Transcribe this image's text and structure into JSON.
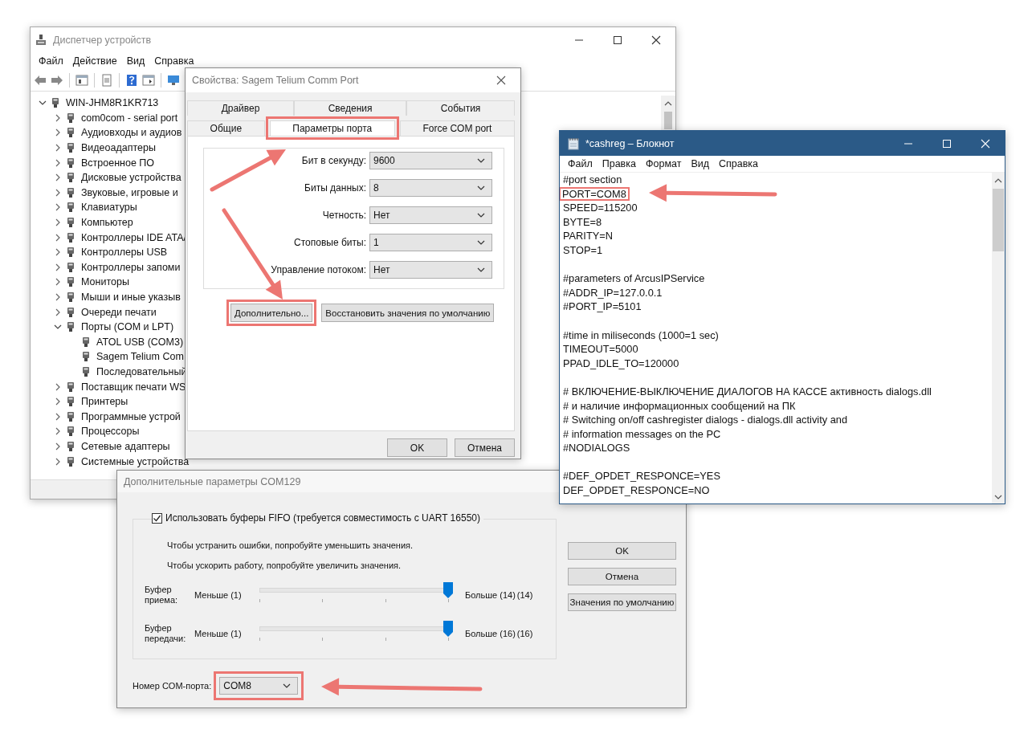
{
  "device_manager": {
    "title": "Диспетчер устройств",
    "menu": [
      "Файл",
      "Действие",
      "Вид",
      "Справка"
    ],
    "tree": [
      {
        "label": "WIN-JHM8R1KR713",
        "expanded": true,
        "children": [
          {
            "label": "com0com - serial port",
            "expanded": false
          },
          {
            "label": "Аудиовходы и аудиов",
            "expanded": false
          },
          {
            "label": "Видеоадаптеры",
            "expanded": false
          },
          {
            "label": "Встроенное ПО",
            "expanded": false
          },
          {
            "label": "Дисковые устройства",
            "expanded": false
          },
          {
            "label": "Звуковые, игровые и",
            "expanded": false
          },
          {
            "label": "Клавиатуры",
            "expanded": false
          },
          {
            "label": "Компьютер",
            "expanded": false
          },
          {
            "label": "Контроллеры IDE ATA/",
            "expanded": false
          },
          {
            "label": "Контроллеры USB",
            "expanded": false
          },
          {
            "label": "Контроллеры запоми",
            "expanded": false
          },
          {
            "label": "Мониторы",
            "expanded": false
          },
          {
            "label": "Мыши и иные указыв",
            "expanded": false
          },
          {
            "label": "Очереди печати",
            "expanded": false
          },
          {
            "label": "Порты (COM и LPT)",
            "expanded": true,
            "children": [
              {
                "label": "ATOL USB (COM3)"
              },
              {
                "label": "Sagem Telium Com"
              },
              {
                "label": "Последовательный"
              }
            ]
          },
          {
            "label": "Поставщик печати WS",
            "expanded": false
          },
          {
            "label": "Принтеры",
            "expanded": false
          },
          {
            "label": "Программные устрой",
            "expanded": false
          },
          {
            "label": "Процессоры",
            "expanded": false
          },
          {
            "label": "Сетевые адаптеры",
            "expanded": false
          },
          {
            "label": "Системные устройства",
            "expanded": false
          }
        ]
      }
    ]
  },
  "properties_dialog": {
    "title": "Свойства: Sagem Telium Comm Port",
    "tab_rows": [
      [
        {
          "label": "Драйвер",
          "selected": false,
          "highlighted": false
        },
        {
          "label": "Сведения",
          "selected": false,
          "highlighted": false
        },
        {
          "label": "События",
          "selected": false,
          "highlighted": false
        }
      ],
      [
        {
          "label": "Общие",
          "selected": false,
          "highlighted": false
        },
        {
          "label": "Параметры порта",
          "selected": true,
          "highlighted": true
        },
        {
          "label": "Force COM port",
          "selected": false,
          "highlighted": false
        }
      ]
    ],
    "fields": [
      {
        "label": "Бит в секунду:",
        "value": "9600"
      },
      {
        "label": "Биты данных:",
        "value": "8"
      },
      {
        "label": "Четность:",
        "value": "Нет"
      },
      {
        "label": "Стоповые биты:",
        "value": "1"
      },
      {
        "label": "Управление потоком:",
        "value": "Нет"
      }
    ],
    "buttons": [
      {
        "label": "Дополнительно...",
        "highlighted": true
      },
      {
        "label": "Восстановить значения по умолчанию",
        "highlighted": false
      }
    ],
    "footer_buttons": [
      "OK",
      "Отмена"
    ]
  },
  "notepad": {
    "title": "*cashreg – Блокнот",
    "menu": [
      "Файл",
      "Правка",
      "Формат",
      "Вид",
      "Справка"
    ],
    "blocks": [
      [
        {
          "text": "#port section",
          "highlighted": false
        },
        {
          "text": "PORT=COM8",
          "highlighted": true
        },
        {
          "text": "SPEED=115200",
          "highlighted": false
        },
        {
          "text": "BYTE=8",
          "highlighted": false
        },
        {
          "text": "PARITY=N",
          "highlighted": false
        },
        {
          "text": "STOP=1",
          "highlighted": false
        }
      ],
      [
        {
          "text": "#parameters of ArcusIPService",
          "highlighted": false
        },
        {
          "text": "#ADDR_IP=127.0.0.1",
          "highlighted": false
        },
        {
          "text": "#PORT_IP=5101",
          "highlighted": false
        }
      ],
      [
        {
          "text": "#time in miliseconds (1000=1 sec)",
          "highlighted": false
        },
        {
          "text": "TIMEOUT=5000",
          "highlighted": false
        },
        {
          "text": "PPAD_IDLE_TO=120000",
          "highlighted": false
        }
      ],
      [
        {
          "text": "# ВКЛЮЧЕНИЕ-ВЫКЛЮЧЕНИЕ ДИАЛОГОВ НА КАССЕ активность dialogs.dll",
          "highlighted": false
        },
        {
          "text": "# и наличие информационных сообщений на ПК",
          "highlighted": false
        },
        {
          "text": "# Switching on/off cashregister dialogs - dialogs.dll activity and",
          "highlighted": false
        },
        {
          "text": "# information messages on the PC",
          "highlighted": false
        },
        {
          "text": "#NODIALOGS",
          "highlighted": false
        }
      ],
      [
        {
          "text": "#DEF_OPDET_RESPONCE=YES",
          "highlighted": false
        },
        {
          "text": "DEF_OPDET_RESPONCE=NO",
          "highlighted": false
        }
      ]
    ]
  },
  "advanced_dialog": {
    "title": "Дополнительные параметры COM129",
    "fifo": {
      "label": "Использовать буферы FIFO (требуется совместимость с UART 16550)",
      "checked": true
    },
    "hints": [
      "Чтобы устранить ошибки, попробуйте уменьшить значения.",
      "Чтобы ускорить работу, попробуйте увеличить значения."
    ],
    "sliders": [
      {
        "label": "Буфер приема:",
        "min_label": "Меньше (1)",
        "max_label": "Больше (14)",
        "reading": "(14)",
        "level": 1
      },
      {
        "label": "Буфер передачи:",
        "min_label": "Меньше (1)",
        "max_label": "Больше (16)",
        "reading": "(16)",
        "level": 1
      }
    ],
    "com_port": {
      "label": "Номер COM-порта:",
      "value": "COM8",
      "highlighted": true
    },
    "buttons": [
      "OK",
      "Отмена",
      "Значения по умолчанию"
    ]
  }
}
